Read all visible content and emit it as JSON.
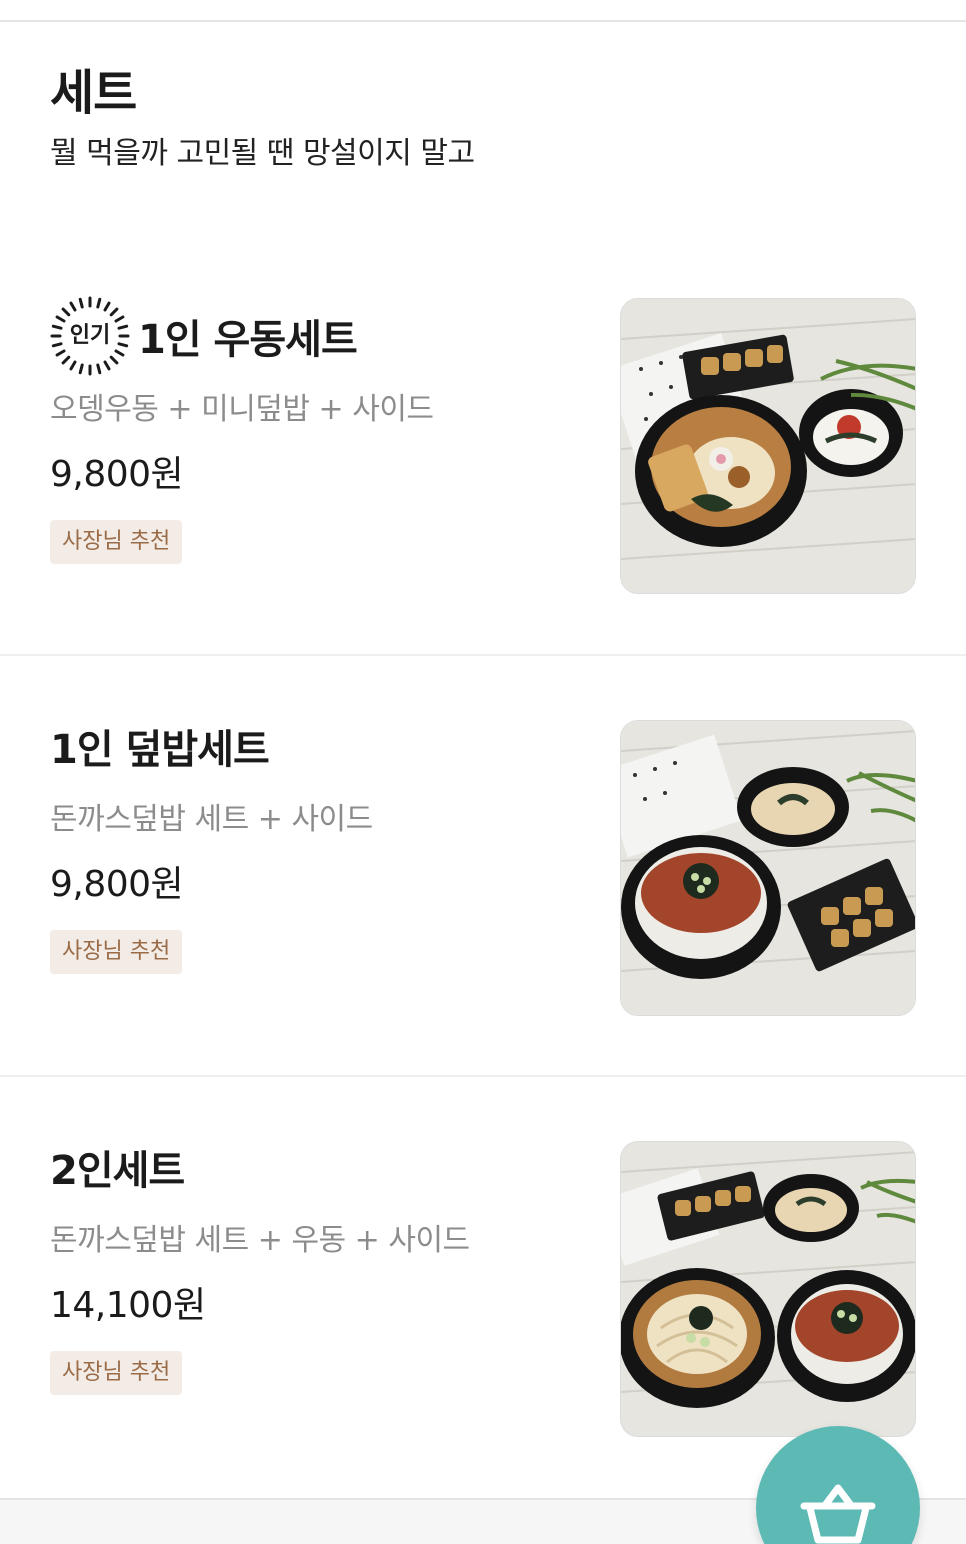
{
  "section": {
    "title": "세트",
    "description": "뭘 먹을까 고민될 땐 망설이지 말고"
  },
  "items": [
    {
      "popular_label": "인기",
      "name": "1인 우동세트",
      "description": "오뎅우동 + 미니덮밥 + 사이드",
      "price": "9,800원",
      "badge": "사장님 추천"
    },
    {
      "name": "1인 덮밥세트",
      "description": "돈까스덮밥 세트 + 사이드",
      "price": "9,800원",
      "badge": "사장님 추천"
    },
    {
      "name": "2인세트",
      "description": "돈까스덮밥 세트 + 우동 + 사이드",
      "price": "14,100원",
      "badge": "사장님 추천"
    }
  ],
  "cart_button": {
    "icon": "basket-icon"
  },
  "colors": {
    "accent": "#5db9b4",
    "badge_bg": "#f3ece6",
    "badge_text": "#9a6b47",
    "muted_text": "#8c8c8c"
  }
}
